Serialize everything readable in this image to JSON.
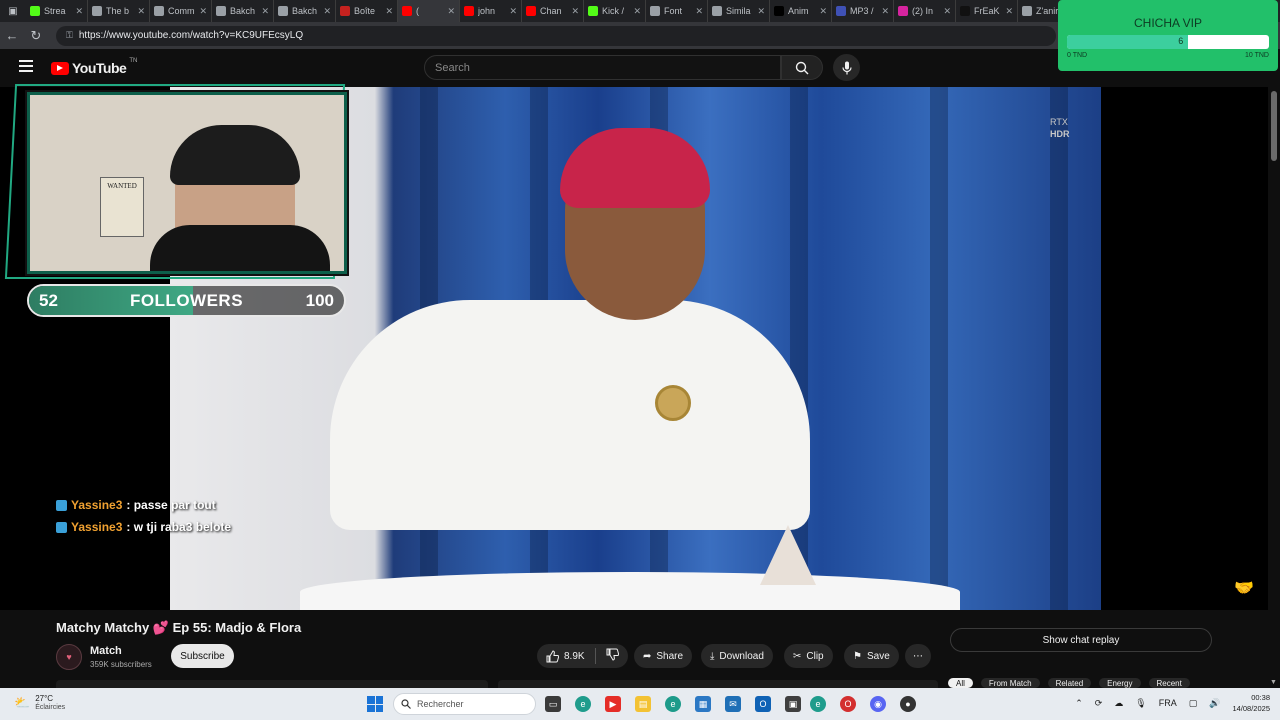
{
  "browser": {
    "tabs": [
      {
        "label": "Strea",
        "icon": "kick-icon",
        "color": "#53fc18"
      },
      {
        "label": "The b",
        "icon": "diamond-icon",
        "color": "#9aa0a6"
      },
      {
        "label": "Comm",
        "icon": "gear-icon",
        "color": "#9aa0a6"
      },
      {
        "label": "Bakch",
        "icon": "page-icon",
        "color": "#9aa0a6"
      },
      {
        "label": "Bakch",
        "icon": "page-icon",
        "color": "#9aa0a6"
      },
      {
        "label": "Boîte",
        "icon": "gmail-icon",
        "color": "#c5221f"
      },
      {
        "label": "(",
        "icon": "youtube-icon",
        "color": "#ff0000",
        "active": true
      },
      {
        "label": "john",
        "icon": "youtube-icon",
        "color": "#ff0000"
      },
      {
        "label": "Chan",
        "icon": "youtube-icon",
        "color": "#ff0000"
      },
      {
        "label": "Kick /",
        "icon": "kick-icon",
        "color": "#53fc18"
      },
      {
        "label": "Font",
        "icon": "globe-icon",
        "color": "#9aa0a6"
      },
      {
        "label": "Simila",
        "icon": "globe-icon",
        "color": "#9aa0a6"
      },
      {
        "label": "Anim",
        "icon": "b-icon",
        "color": "#000000"
      },
      {
        "label": "MP3 /",
        "icon": "mp3-icon",
        "color": "#3f51b5"
      },
      {
        "label": "(2) In",
        "icon": "instagram-icon",
        "color": "#d6249f"
      },
      {
        "label": "FrEaK",
        "icon": "tiktok-icon",
        "color": "#111111"
      },
      {
        "label": "Z'anir",
        "icon": "globe-icon",
        "color": "#9aa0a6"
      }
    ],
    "url": "https://www.youtube.com/watch?v=KC9UFEcsyLQ"
  },
  "youtube": {
    "logo_text": "YouTube",
    "country_code": "TN",
    "search_placeholder": "Search"
  },
  "video": {
    "badge_line1": "RTX",
    "badge_line2": "HDR",
    "title": "Matchy Matchy",
    "title_emoji": "💕",
    "title_rest": "Ep 55: Madjo & Flora",
    "channel_name": "Match",
    "subscribers": "359K subscribers",
    "subscribe_label": "Subscribe",
    "likes": "8.9K",
    "share_label": "Share",
    "download_label": "Download",
    "clip_label": "Clip",
    "save_label": "Save",
    "chat_replay_label": "Show chat replay",
    "chips": [
      "All",
      "From Match",
      "Related",
      "Energy",
      "Recent"
    ]
  },
  "overlay": {
    "webcam_poster": "WANTED",
    "followers_current": "52",
    "followers_label": "FOLLOWERS",
    "followers_goal": "100",
    "followers_progress": 0.52,
    "chat": [
      {
        "user": "Yassine3",
        "message": ": passe par tout"
      },
      {
        "user": "Yassine3",
        "message": ": w tji raba3 belote"
      }
    ],
    "donation_title": "CHICHA VIP",
    "donation_value": "6",
    "donation_progress": 0.6,
    "donation_min": "0 TND",
    "donation_max": "10 TND"
  },
  "taskbar": {
    "weather_temp": "27°C",
    "weather_condition": "Éclaircies",
    "search_placeholder": "Rechercher",
    "language": "FRA",
    "time": "00:38",
    "date": "14/08/2025"
  }
}
